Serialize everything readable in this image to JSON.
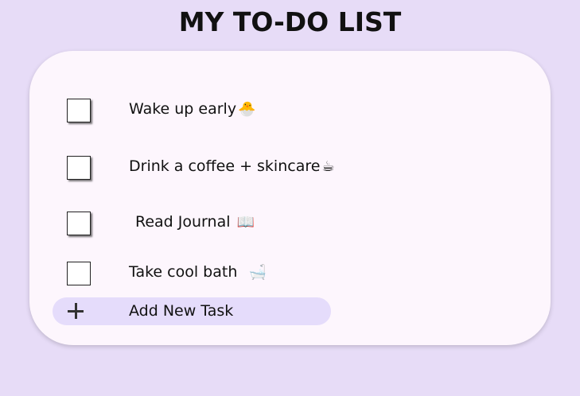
{
  "page": {
    "title": "MY TO-DO LIST"
  },
  "tasks": [
    {
      "text": "Wake up early",
      "emoji": "🐣",
      "checked": false
    },
    {
      "text": "Drink a coffee + skincare",
      "emoji": "☕",
      "checked": false
    },
    {
      "text": "Read Journal",
      "emoji": "📖",
      "checked": false
    },
    {
      "text": "Take cool bath",
      "emoji": "🛁",
      "checked": false
    }
  ],
  "add_task": {
    "label": "Add New Task",
    "icon": "plus-icon"
  },
  "colors": {
    "background": "#e7dcf7",
    "card": "#fdf6fd",
    "add_row": "#e5dcfb"
  }
}
